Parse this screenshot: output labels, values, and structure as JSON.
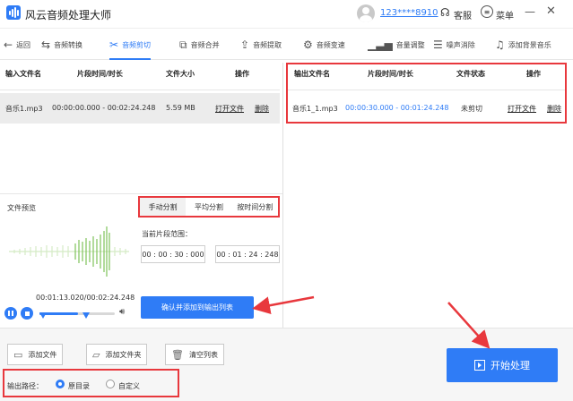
{
  "app": {
    "title": "风云音频处理大师",
    "user_id": "123****8910",
    "service_label": "客服",
    "menu_label": "菜单",
    "minimize": "—",
    "close": "✕"
  },
  "toolbar": {
    "back": "返回",
    "items": [
      {
        "label": "音频转换",
        "icon": "convert-icon"
      },
      {
        "label": "音频剪切",
        "icon": "scissors-icon",
        "active": true
      },
      {
        "label": "音频合并",
        "icon": "merge-icon"
      },
      {
        "label": "音频提取",
        "icon": "extract-icon"
      },
      {
        "label": "音频变速",
        "icon": "speed-icon"
      },
      {
        "label": "音量调整",
        "icon": "volume-bars-icon"
      },
      {
        "label": "噪声消除",
        "icon": "noise-icon"
      },
      {
        "label": "添加背景音乐",
        "icon": "music-note-icon"
      }
    ]
  },
  "input_table": {
    "headers": [
      "输入文件名",
      "片段时间/时长",
      "文件大小",
      "操作"
    ],
    "rows": [
      {
        "name": "音乐1.mp3",
        "range": "00:00:00.000 - 00:02:24.248",
        "size": "5.59 MB",
        "open": "打开文件",
        "delete": "删除"
      }
    ]
  },
  "output_table": {
    "headers": [
      "输出文件名",
      "片段时间/时长",
      "文件状态",
      "操作"
    ],
    "rows": [
      {
        "name": "音乐1_1.mp3",
        "range": "00:00:30.000 - 00:01:24.248",
        "status": "未剪切",
        "open": "打开文件",
        "delete": "删除"
      }
    ]
  },
  "preview": {
    "label": "文件预览",
    "tabs": [
      "手动分割",
      "平均分割",
      "按时间分割"
    ],
    "active_tab": 0,
    "range_label": "当前片段范围：",
    "start_time": "00 : 00 : 30 : 000",
    "end_time": "00 : 01 : 24 : 248",
    "playback_time": "00:01:13.020/00:02:24.248",
    "playback_progress": 0.507,
    "confirm_button": "确认并添加到输出列表"
  },
  "bottom": {
    "add_file": "添加文件",
    "add_folder": "添加文件夹",
    "clear_list": "清空列表",
    "output_path_label": "输出路径：",
    "option_original": "原目录",
    "option_custom": "自定义",
    "start_button": "开始处理"
  },
  "colors": {
    "accent": "#2f7cf6",
    "highlight_red": "#e8383d",
    "waveform_green": "#7ec35a"
  }
}
